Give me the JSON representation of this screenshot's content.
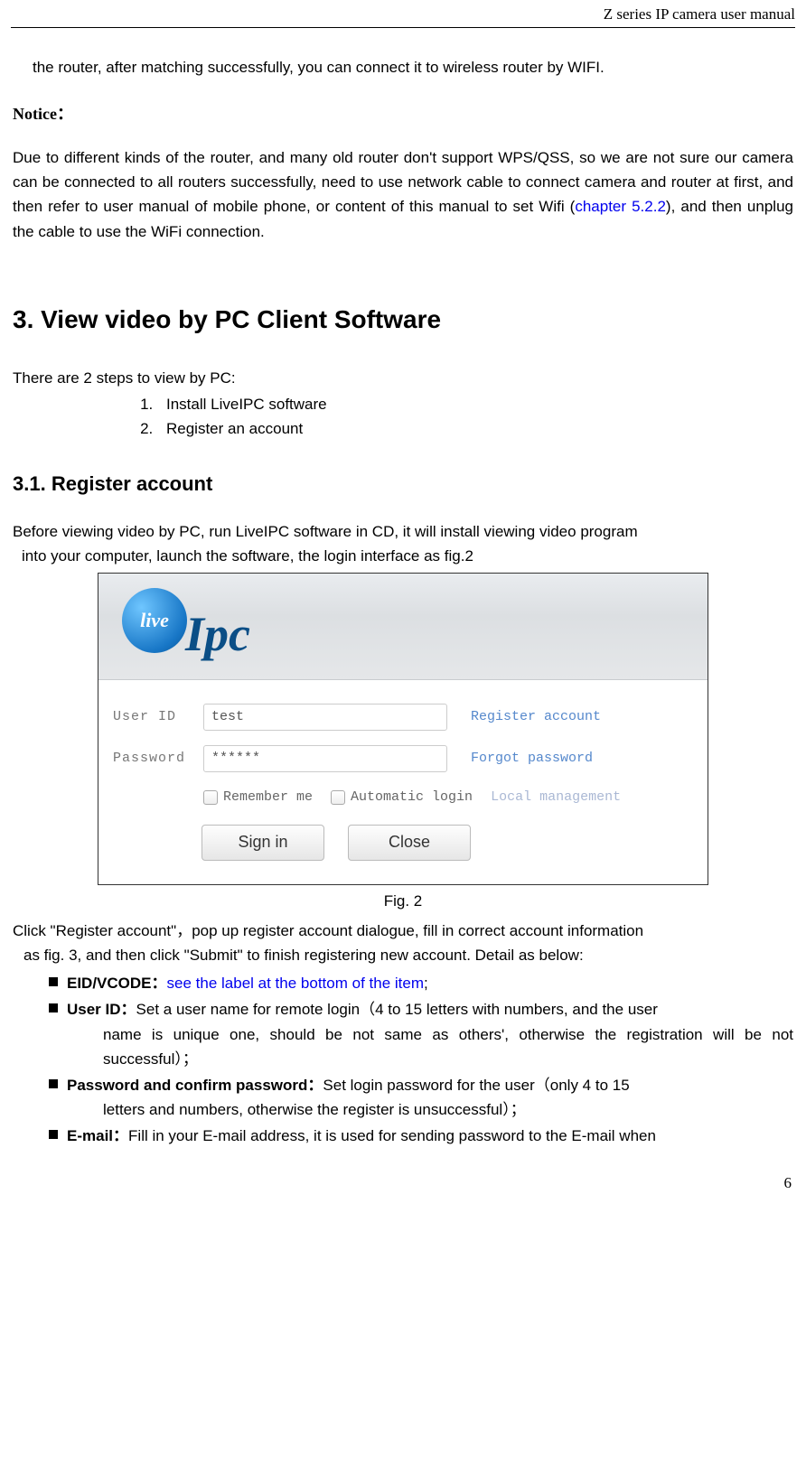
{
  "header": {
    "title": "Z series IP camera user manual"
  },
  "para1": "the router, after matching successfully, you can connect it to wireless router by WIFI.",
  "notice_label": "Notice：",
  "notice_body_pre": "Due to different kinds of the router, and many old router don't support WPS/QSS, so we are not sure our camera can be connected to all routers successfully, need to use network cable to connect camera and router at first, and then refer to user manual of mobile phone, or content of this manual to set Wifi (",
  "notice_link": "chapter 5.2.2",
  "notice_body_post": "), and then unplug the cable to use the WiFi connection.",
  "section3": {
    "num": "3.",
    "title": "View video by PC Client Software"
  },
  "steps_intro": "There are 2 steps to view by PC:",
  "steps": [
    "Install LiveIPC software",
    "Register an account"
  ],
  "section31": {
    "num": "3.1.",
    "title": "Register account"
  },
  "before_para_a": "Before viewing video by PC, run LiveIPC software in CD, it will install viewing video program",
  "before_para_b": "into your computer, launch the software, the login interface as fig.2",
  "fig": {
    "logo_live": "live",
    "logo_ipc": "Ipc",
    "user_label": "User  ID",
    "user_value": "test",
    "register_link": "Register account",
    "pass_label": "Password",
    "pass_value": "******",
    "forgot_link": "Forgot password",
    "remember": "Remember me",
    "auto": "Automatic login",
    "local_mgmt": "Local management",
    "signin": "Sign in",
    "close": "Close",
    "caption": "Fig. 2"
  },
  "after_click_a": "Click \"Register account\"，pop up register account dialogue, fill in correct account information",
  "after_click_b": "as fig. 3, and then click \"Submit\" to finish registering new account. Detail as below:",
  "bullets": {
    "eid_label": "EID/VCODE：",
    "eid_link": "see the label at the bottom of the item",
    "eid_post": ";",
    "userid_label": "User ID：",
    "userid_text_a": "Set a user name for remote login（4 to 15 letters with numbers, and the user",
    "userid_text_b": "name is unique one, should be not same as others', otherwise the registration will be not successful）；",
    "pwd_label": "Password and confirm password：",
    "pwd_text_a": "Set login password for the user（only 4 to 15",
    "pwd_text_b": "letters and numbers, otherwise the register is unsuccessful）；",
    "email_label": "E-mail：",
    "email_text": "Fill in your E-mail address, it is used for sending password to the E-mail when"
  },
  "page_number": "6"
}
